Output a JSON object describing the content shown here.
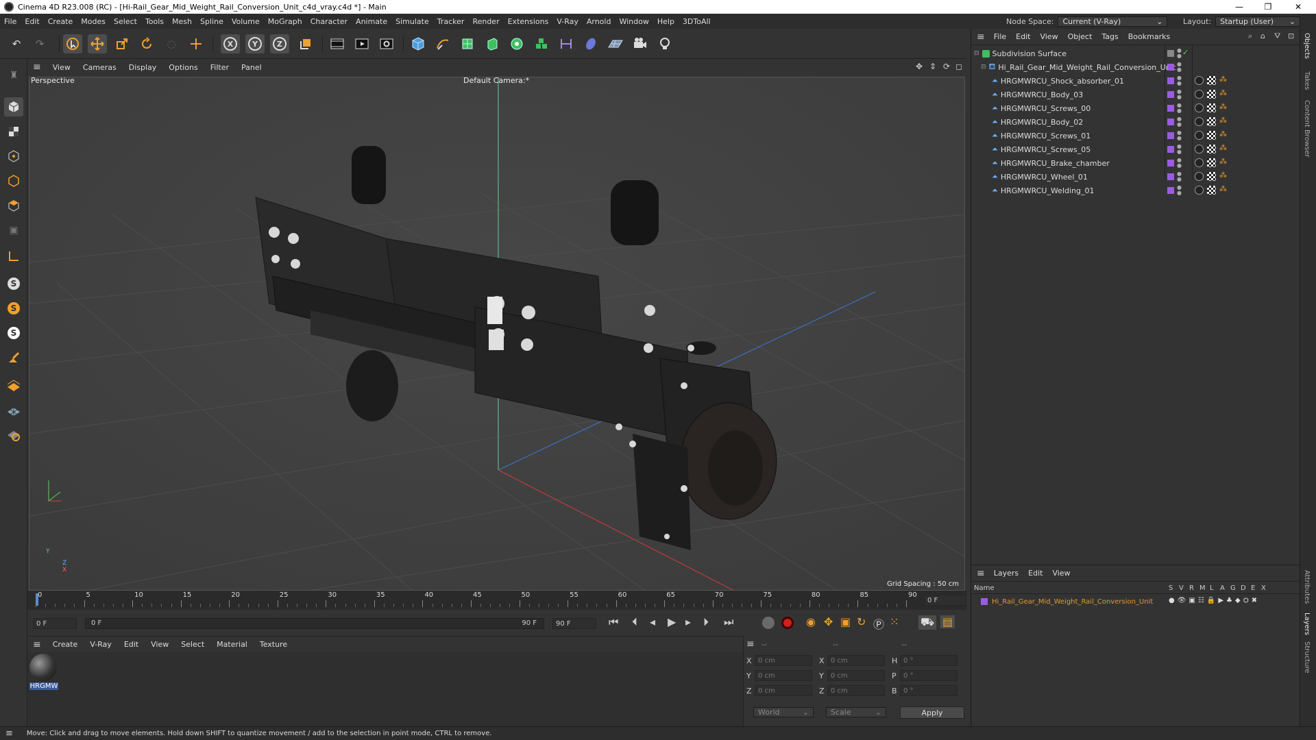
{
  "titlebar": {
    "title": "Cinema 4D R23.008 (RC) - [Hi-Rail_Gear_Mid_Weight_Rail_Conversion_Unit_c4d_vray.c4d *] - Main",
    "minimize": "—",
    "maximize": "❐",
    "close": "✕"
  },
  "menubar": {
    "items": [
      "File",
      "Edit",
      "Create",
      "Modes",
      "Select",
      "Tools",
      "Mesh",
      "Spline",
      "Volume",
      "MoGraph",
      "Character",
      "Animate",
      "Simulate",
      "Tracker",
      "Render",
      "Extensions",
      "V-Ray",
      "Arnold",
      "Window",
      "Help",
      "3DToAll"
    ],
    "node_space_label": "Node Space:",
    "node_space_value": "Current (V-Ray)",
    "layout_label": "Layout:",
    "layout_value": "Startup (User)"
  },
  "viewport_menu": {
    "items": [
      "View",
      "Cameras",
      "Display",
      "Options",
      "Filter",
      "Panel"
    ]
  },
  "viewport": {
    "label": "Perspective",
    "camera": "Default Camera",
    "camera_suffix": ":*",
    "grid_spacing": "Grid Spacing : 50 cm",
    "axis_y": "Y",
    "axis_z": "Z",
    "axis_x": "X"
  },
  "timeline": {
    "ticks": [
      "0",
      "5",
      "10",
      "15",
      "20",
      "25",
      "30",
      "35",
      "40",
      "45",
      "50",
      "55",
      "60",
      "65",
      "70",
      "75",
      "80",
      "85",
      "90"
    ],
    "current_frame": "0 F"
  },
  "playbar": {
    "start_field": "0 F",
    "range_start": "0 F",
    "range_end": "90 F",
    "end_field": "90 F"
  },
  "material_menu": {
    "items": [
      "Create",
      "V-Ray",
      "Edit",
      "View",
      "Select",
      "Material",
      "Texture"
    ]
  },
  "material": {
    "name": "HRGMW"
  },
  "coords": {
    "headers": [
      "--",
      "--",
      "--"
    ],
    "rows": [
      {
        "a": "X",
        "av": "0 cm",
        "b": "X",
        "bv": "0 cm",
        "c": "H",
        "cv": "0 °"
      },
      {
        "a": "Y",
        "av": "0 cm",
        "b": "Y",
        "bv": "0 cm",
        "c": "P",
        "cv": "0 °"
      },
      {
        "a": "Z",
        "av": "0 cm",
        "b": "Z",
        "bv": "0 cm",
        "c": "B",
        "cv": "0 °"
      }
    ],
    "mode": "World",
    "transform": "Scale",
    "apply": "Apply"
  },
  "object_manager": {
    "menu": [
      "File",
      "Edit",
      "View",
      "Object",
      "Tags",
      "Bookmarks"
    ],
    "root": "Subdivision Surface",
    "group": "Hi_Rail_Gear_Mid_Weight_Rail_Conversion_Unit",
    "objects": [
      "HRGMWRCU_Shock_absorber_01",
      "HRGMWRCU_Body_03",
      "HRGMWRCU_Screws_00",
      "HRGMWRCU_Body_02",
      "HRGMWRCU_Screws_01",
      "HRGMWRCU_Screws_05",
      "HRGMWRCU_Brake_chamber",
      "HRGMWRCU_Wheel_01",
      "HRGMWRCU_Welding_01"
    ]
  },
  "layers": {
    "menu": [
      "Layers",
      "Edit",
      "View"
    ],
    "name_header": "Name",
    "col_headers": [
      "S",
      "V",
      "R",
      "M",
      "L",
      "A",
      "G",
      "D",
      "E",
      "X"
    ],
    "layer_name": "Hi_Rail_Gear_Mid_Weight_Rail_Conversion_Unit"
  },
  "side_tabs": [
    "Objects",
    "Takes",
    "Content Browser",
    "Attributes",
    "Layers",
    "Structure"
  ],
  "status": "Move: Click and drag to move elements. Hold down SHIFT to quantize movement / add to the selection in point mode, CTRL to remove.",
  "colors": {
    "accent": "#f0a030",
    "layer_purple": "#9a5ce0",
    "check_green": "#5fd05f",
    "layer_name": "#e09a30"
  }
}
